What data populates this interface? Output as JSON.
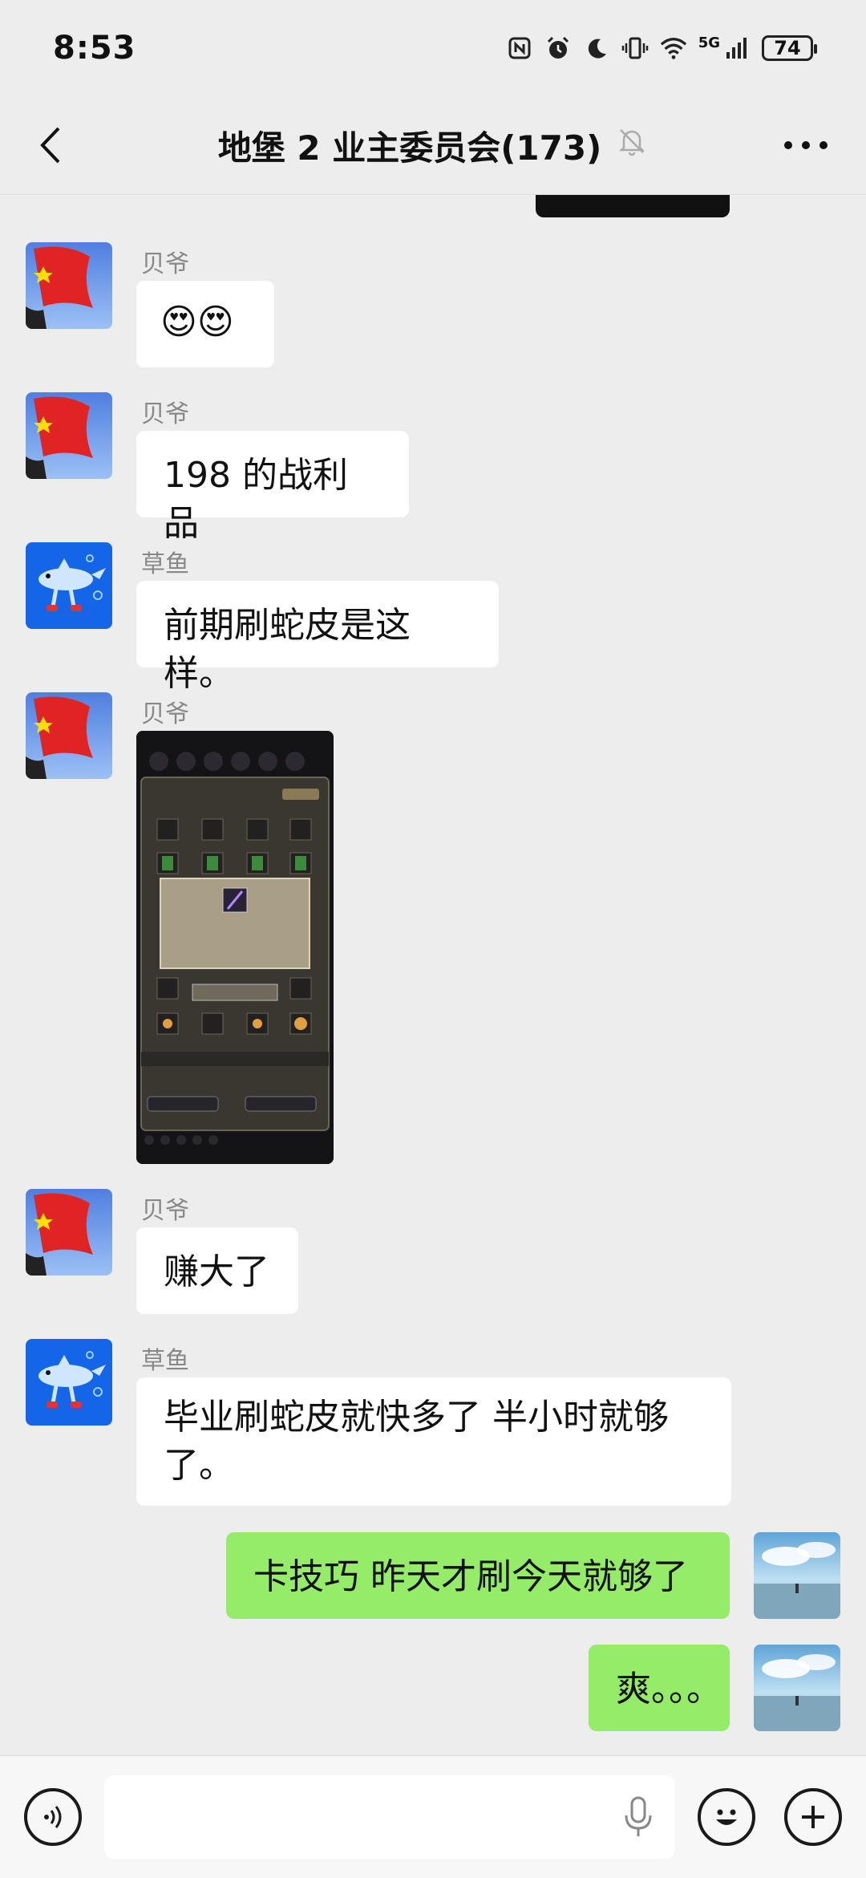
{
  "status_bar": {
    "time": "8:53",
    "network": "5G",
    "battery": "74"
  },
  "header": {
    "title": "地堡 2 业主委员会(173)"
  },
  "messages": [
    {
      "sender": "贝爷",
      "text": "😍😍"
    },
    {
      "sender": "贝爷",
      "text": "198 的战利品"
    },
    {
      "sender": "草鱼",
      "text": "前期刷蛇皮是这样。"
    },
    {
      "sender": "贝爷",
      "type": "image"
    },
    {
      "sender": "贝爷",
      "text": "赚大了"
    },
    {
      "sender": "草鱼",
      "text": "毕业刷蛇皮就快多了 半小时就够了。"
    },
    {
      "sender": "me",
      "text": "卡技巧 昨天才刷今天就够了"
    },
    {
      "sender": "me",
      "text": "爽。。。"
    }
  ],
  "colors": {
    "background": "#ededed",
    "my_bubble": "#95ec69",
    "other_bubble": "#ffffff"
  }
}
